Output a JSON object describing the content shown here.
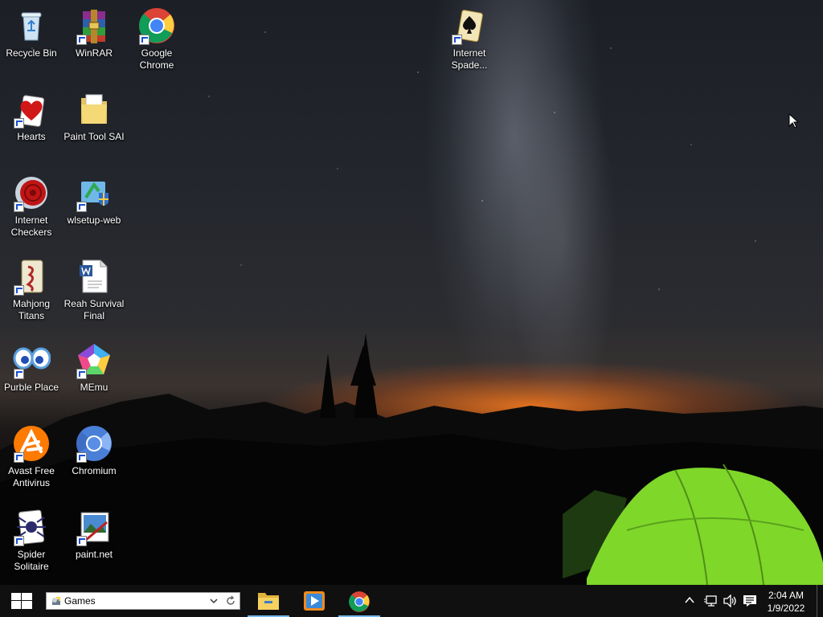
{
  "desktop": {
    "icons": [
      {
        "id": "recycle-bin",
        "label": "Recycle Bin"
      },
      {
        "id": "winrar",
        "label": "WinRAR"
      },
      {
        "id": "google-chrome",
        "label": "Google Chrome"
      },
      {
        "id": "internet-spades",
        "label": "Internet Spade..."
      },
      {
        "id": "hearts",
        "label": "Hearts"
      },
      {
        "id": "paint-tool-sai",
        "label": "Paint Tool SAI"
      },
      {
        "id": "internet-checkers",
        "label": "Internet Checkers"
      },
      {
        "id": "wlsetup-web",
        "label": "wlsetup-web"
      },
      {
        "id": "mahjong-titans",
        "label": "Mahjong Titans"
      },
      {
        "id": "reah-survival-final",
        "label": "Reah Survival Final"
      },
      {
        "id": "purble-place",
        "label": "Purble Place"
      },
      {
        "id": "memu",
        "label": "MEmu"
      },
      {
        "id": "avast-free-antivirus",
        "label": "Avast Free Antivirus"
      },
      {
        "id": "chromium",
        "label": "Chromium"
      },
      {
        "id": "spider-solitaire",
        "label": "Spider Solitaire"
      },
      {
        "id": "paint-net",
        "label": "paint.net"
      }
    ]
  },
  "taskbar": {
    "search": {
      "value": "Games"
    },
    "pinned": [
      {
        "id": "file-explorer",
        "icon": "folder-icon",
        "active": true
      },
      {
        "id": "media-player",
        "icon": "play-icon",
        "active": false
      },
      {
        "id": "chrome",
        "icon": "chrome-icon",
        "active": true
      }
    ],
    "clock": {
      "time": "2:04 AM",
      "date": "1/9/2022"
    }
  },
  "colors": {
    "taskbar": "#101010",
    "accent": "#76b9ed"
  }
}
